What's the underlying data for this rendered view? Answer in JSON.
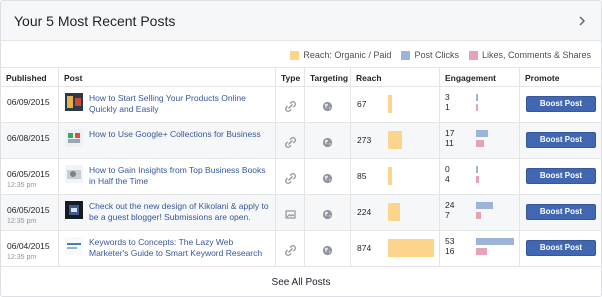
{
  "header": {
    "title": "Your 5 Most Recent Posts",
    "chevron_icon": "chevron-right-icon"
  },
  "legend": [
    {
      "label": "Reach: Organic / Paid",
      "color": "#fcd48c"
    },
    {
      "label": "Post Clicks",
      "color": "#9cb4d8"
    },
    {
      "label": "Likes, Comments & Shares",
      "color": "#e8a2b6"
    }
  ],
  "columns": {
    "published": "Published",
    "post": "Post",
    "type": "Type",
    "targeting": "Targeting",
    "reach": "Reach",
    "engagement": "Engagement",
    "promote": "Promote"
  },
  "rows": [
    {
      "date": "06/09/2015",
      "time": "",
      "title": "How to Start Selling Your Products Online Quickly and Easily",
      "type_icon": "link-icon",
      "targeting_icon": "globe-icon",
      "reach": "67",
      "reach_value": 67,
      "clicks": "3",
      "clicks_value": 3,
      "likes": "1",
      "likes_value": 1,
      "promote_label": "Boost Post"
    },
    {
      "date": "06/08/2015",
      "time": "",
      "title": "How to Use Google+ Collections for Business",
      "type_icon": "link-icon",
      "targeting_icon": "globe-icon",
      "reach": "273",
      "reach_value": 273,
      "clicks": "17",
      "clicks_value": 17,
      "likes": "11",
      "likes_value": 11,
      "promote_label": "Boost Post"
    },
    {
      "date": "06/05/2015",
      "time": "12:35 pm",
      "title": "How to Gain Insights from Top Business Books in Half the Time",
      "type_icon": "link-icon",
      "targeting_icon": "globe-icon",
      "reach": "85",
      "reach_value": 85,
      "clicks": "0",
      "clicks_value": 0,
      "likes": "4",
      "likes_value": 4,
      "promote_label": "Boost Post"
    },
    {
      "date": "06/05/2015",
      "time": "12:35 pm",
      "title": "Check out the new design of Kikolani & apply to be a guest blogger! Submissions are open.",
      "type_icon": "photo-icon",
      "targeting_icon": "globe-icon",
      "reach": "224",
      "reach_value": 224,
      "clicks": "24",
      "clicks_value": 24,
      "likes": "7",
      "likes_value": 7,
      "promote_label": "Boost Post"
    },
    {
      "date": "06/04/2015",
      "time": "12:35 pm",
      "title": "Keywords to Concepts: The Lazy Web Marketer's Guide to Smart Keyword Research",
      "type_icon": "link-icon",
      "targeting_icon": "globe-icon",
      "reach": "874",
      "reach_value": 874,
      "clicks": "53",
      "clicks_value": 53,
      "likes": "16",
      "likes_value": 16,
      "promote_label": "Boost Post"
    }
  ],
  "footer": {
    "see_all_label": "See All Posts"
  }
}
